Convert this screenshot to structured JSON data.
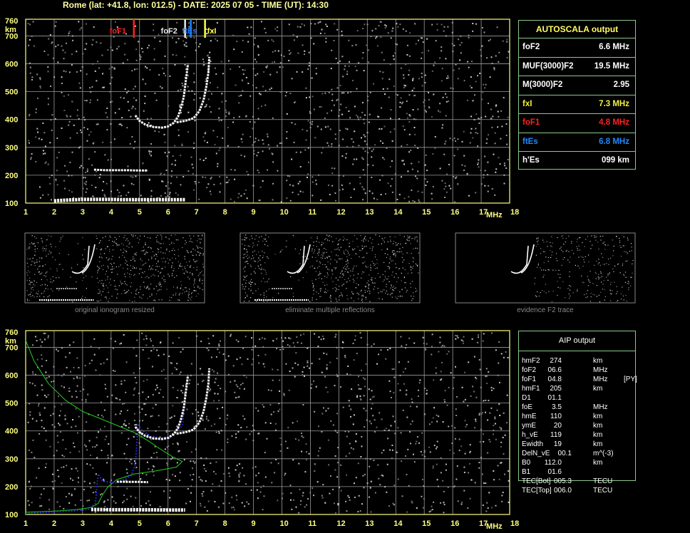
{
  "header": {
    "title": "Rome (lat: +41.8, lon: 012.5) - DATE: 2025 07 05 - TIME (UT): 14:30"
  },
  "colors": {
    "axis": "#ffff80",
    "grid": "#9a9a9a",
    "panel_border": "#8cc88c",
    "foF1": "#ff2020",
    "foF2": "#e0e0e0",
    "ftEs": "#2080ff",
    "fxI": "#ffff40",
    "profile": "#20d020",
    "fit": "#3030ff",
    "caption": "#888888"
  },
  "autoscala": {
    "title": "AUTOSCALA output",
    "rows": [
      {
        "label": "foF2",
        "value": "6.6 MHz",
        "color": "#ffffff"
      },
      {
        "label": "MUF(3000)F2",
        "value": "19.5 MHz",
        "color": "#ffffff"
      },
      {
        "label": "M(3000)F2",
        "value": "2.95",
        "color": "#ffffff"
      },
      {
        "label": "fxI",
        "value": "7.3 MHz",
        "color": "#f0f040"
      },
      {
        "label": "foF1",
        "value": "4.8 MHz",
        "color": "#ff2020"
      },
      {
        "label": "ftEs",
        "value": "6.8 MHz",
        "color": "#2088ff"
      },
      {
        "label": "h'Es",
        "value": "099    km",
        "color": "#ffffff"
      }
    ]
  },
  "aip": {
    "title": "AIP output",
    "rows": [
      {
        "label": "hmF2",
        "value": "274",
        "unit": "km",
        "flag": ""
      },
      {
        "label": "foF2",
        "value": "06.6",
        "unit": "MHz",
        "flag": ""
      },
      {
        "label": "foF1",
        "value": "04.8",
        "unit": "MHz",
        "flag": "[PY]"
      },
      {
        "label": "hmF1",
        "value": "205",
        "unit": "km",
        "flag": ""
      },
      {
        "label": "D1",
        "value": "01.1",
        "unit": "",
        "flag": ""
      },
      {
        "label": "foE",
        "value": "3.5",
        "unit": "MHz",
        "flag": ""
      },
      {
        "label": "hmE",
        "value": "110",
        "unit": "km",
        "flag": ""
      },
      {
        "label": "ymE",
        "value": "20",
        "unit": "km",
        "flag": ""
      },
      {
        "label": "h_vE",
        "value": "119",
        "unit": "km",
        "flag": ""
      },
      {
        "label": "Ewidth",
        "value": "19",
        "unit": "km",
        "flag": ""
      },
      {
        "label": "DelN_vE",
        "value": "00.1",
        "unit": "m^(-3)",
        "flag": ""
      },
      {
        "label": "B0",
        "value": "112.0",
        "unit": "km",
        "flag": ""
      },
      {
        "label": "B1",
        "value": "01.6",
        "unit": "",
        "flag": ""
      },
      {
        "label": "TEC[Bot]",
        "value": "005.3",
        "unit": "TECU",
        "flag": ""
      },
      {
        "label": "TEC[Top]",
        "value": "006.0",
        "unit": "TECU",
        "flag": ""
      }
    ]
  },
  "thumbnails": {
    "captions": [
      "original ionogram resized",
      "eliminate multiple reflections",
      "evidence F2 trace"
    ]
  },
  "chart_data": [
    {
      "type": "scatter",
      "title": "",
      "xlabel": "MHz",
      "ylabel": "km",
      "xlim": [
        1,
        18
      ],
      "ylim": [
        100,
        760
      ],
      "xticks": [
        "1",
        "2",
        "3",
        "4",
        "5",
        "6",
        "7",
        "8",
        "9",
        "10",
        "11",
        "12",
        "13",
        "14",
        "15",
        "16",
        "17",
        "18"
      ],
      "yticks": [
        "100",
        "200",
        "300",
        "400",
        "500",
        "600",
        "700",
        "760"
      ],
      "grid": true,
      "markers": [
        {
          "name": "foF1",
          "freq": 4.8,
          "color": "#ff2020"
        },
        {
          "name": "foF2",
          "freq": 6.6,
          "color": "#e8e8e8"
        },
        {
          "name": "ftEs",
          "freq": 6.8,
          "color": "#2080ff"
        },
        {
          "name": "fxI",
          "freq": 7.3,
          "color": "#ffff40"
        }
      ],
      "series": [
        {
          "trace": "Es",
          "points": [
            [
              2,
              108
            ],
            [
              2.5,
              111
            ],
            [
              3,
              113
            ],
            [
              3.5,
              113
            ],
            [
              4,
              113
            ],
            [
              4.5,
              112
            ],
            [
              5,
              112
            ],
            [
              5.5,
              112
            ],
            [
              6,
              112
            ],
            [
              6.6,
              112
            ]
          ]
        },
        {
          "trace": "Es2",
          "points": [
            [
              3.4,
              220
            ],
            [
              3.8,
              218
            ],
            [
              4.2,
              218
            ],
            [
              4.6,
              218
            ],
            [
              5.0,
              217
            ],
            [
              5.3,
              217
            ]
          ]
        },
        {
          "trace": "F-o",
          "points": [
            [
              4.85,
              415
            ],
            [
              5.0,
              395
            ],
            [
              5.2,
              382
            ],
            [
              5.5,
              373
            ],
            [
              5.8,
              371
            ],
            [
              6.0,
              375
            ],
            [
              6.2,
              388
            ],
            [
              6.35,
              410
            ],
            [
              6.45,
              440
            ],
            [
              6.55,
              480
            ],
            [
              6.6,
              520
            ],
            [
              6.65,
              560
            ],
            [
              6.7,
              600
            ]
          ]
        },
        {
          "trace": "F-x",
          "points": [
            [
              6.3,
              390
            ],
            [
              6.6,
              395
            ],
            [
              6.9,
              405
            ],
            [
              7.1,
              430
            ],
            [
              7.25,
              470
            ],
            [
              7.35,
              520
            ],
            [
              7.42,
              570
            ],
            [
              7.45,
              625
            ]
          ]
        }
      ]
    },
    {
      "type": "line",
      "title": "",
      "xlabel": "MHz",
      "ylabel": "km",
      "xlim": [
        1,
        18
      ],
      "ylim": [
        100,
        760
      ],
      "xticks": [
        "1",
        "2",
        "3",
        "4",
        "5",
        "6",
        "7",
        "8",
        "9",
        "10",
        "11",
        "12",
        "13",
        "14",
        "15",
        "16",
        "17",
        "18"
      ],
      "yticks": [
        "100",
        "200",
        "300",
        "400",
        "500",
        "600",
        "700",
        "760"
      ],
      "grid": true,
      "series": [
        {
          "trace": "profile",
          "color": "#20d020",
          "points": [
            [
              1.0,
              725
            ],
            [
              1.3,
              650
            ],
            [
              1.8,
              570
            ],
            [
              2.4,
              510
            ],
            [
              3.0,
              470
            ],
            [
              3.6,
              445
            ],
            [
              4.2,
              420
            ],
            [
              4.8,
              395
            ],
            [
              5.3,
              365
            ],
            [
              5.8,
              330
            ],
            [
              6.2,
              305
            ],
            [
              6.5,
              290
            ],
            [
              6.3,
              270
            ],
            [
              5.5,
              255
            ],
            [
              4.8,
              245
            ],
            [
              4.2,
              225
            ],
            [
              3.9,
              200
            ],
            [
              3.7,
              170
            ],
            [
              3.55,
              140
            ],
            [
              3.3,
              125
            ],
            [
              2.8,
              118
            ],
            [
              2.2,
              113
            ],
            [
              1.5,
              110
            ],
            [
              1.0,
              108
            ]
          ]
        },
        {
          "trace": "fit",
          "color": "#3030ff",
          "points": [
            [
              1.0,
              103
            ],
            [
              1.8,
              108
            ],
            [
              2.6,
              112
            ],
            [
              3.2,
              118
            ],
            [
              3.45,
              140
            ],
            [
              3.5,
              200
            ],
            [
              3.55,
              245
            ],
            [
              3.7,
              220
            ],
            [
              4.2,
              212
            ],
            [
              4.7,
              240
            ],
            [
              4.85,
              280
            ],
            [
              4.9,
              350
            ],
            [
              4.95,
              420
            ],
            [
              5.1,
              400
            ],
            [
              5.4,
              380
            ],
            [
              5.8,
              375
            ],
            [
              6.2,
              385
            ],
            [
              6.5,
              420
            ],
            [
              6.6,
              500
            ]
          ]
        },
        {
          "trace": "F-o",
          "points": [
            [
              4.85,
              415
            ],
            [
              5.0,
              395
            ],
            [
              5.2,
              382
            ],
            [
              5.5,
              373
            ],
            [
              5.8,
              371
            ],
            [
              6.0,
              375
            ],
            [
              6.2,
              388
            ],
            [
              6.35,
              410
            ],
            [
              6.45,
              440
            ],
            [
              6.55,
              480
            ],
            [
              6.6,
              520
            ],
            [
              6.65,
              560
            ],
            [
              6.7,
              600
            ]
          ]
        },
        {
          "trace": "F-x",
          "points": [
            [
              6.3,
              390
            ],
            [
              6.6,
              395
            ],
            [
              6.9,
              405
            ],
            [
              7.1,
              430
            ],
            [
              7.25,
              470
            ],
            [
              7.35,
              520
            ],
            [
              7.42,
              570
            ],
            [
              7.45,
              625
            ]
          ]
        },
        {
          "trace": "Es",
          "points": [
            [
              3.3,
              118
            ],
            [
              4,
              117
            ],
            [
              5,
              117
            ],
            [
              6,
              116
            ],
            [
              6.6,
              116
            ]
          ]
        },
        {
          "trace": "Es2",
          "points": [
            [
              4.2,
              218
            ],
            [
              4.6,
              217
            ],
            [
              5.0,
              217
            ],
            [
              5.3,
              216
            ]
          ]
        }
      ]
    }
  ]
}
